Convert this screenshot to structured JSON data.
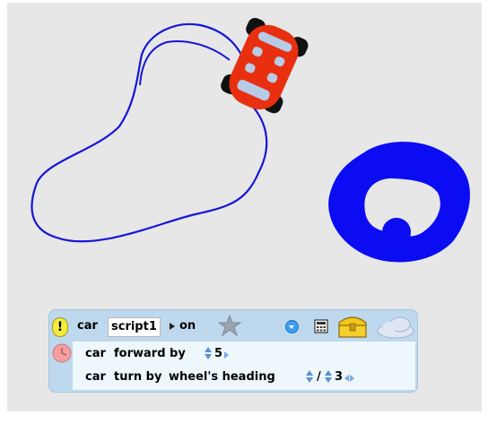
{
  "script": {
    "object_name": "car",
    "script_name": "script1",
    "status": "on",
    "alert_glyph": "!",
    "lines": [
      {
        "subject": "car",
        "command": "forward by",
        "value": "5"
      },
      {
        "subject": "car",
        "command": "turn by",
        "expr_label": "wheel's heading",
        "operator": "/",
        "value": "3"
      }
    ]
  },
  "icons": {
    "alert": "exclamation-icon",
    "status": "play-triangle-icon",
    "star": "star-icon",
    "menu": "menu-dropdown-icon",
    "calculator": "calculator-icon",
    "chest": "treasure-chest-icon",
    "cloud": "cloud-icon",
    "clock": "clock-icon",
    "car": "car-sprite",
    "blob": "painted-blob"
  },
  "colors": {
    "world_bg": "#e7e7e7",
    "trail": "#1616d8",
    "blob": "#0c0cf2",
    "car": "#e83010",
    "script_bg": "#bed9ee",
    "script_body_bg": "#eef7fb"
  }
}
